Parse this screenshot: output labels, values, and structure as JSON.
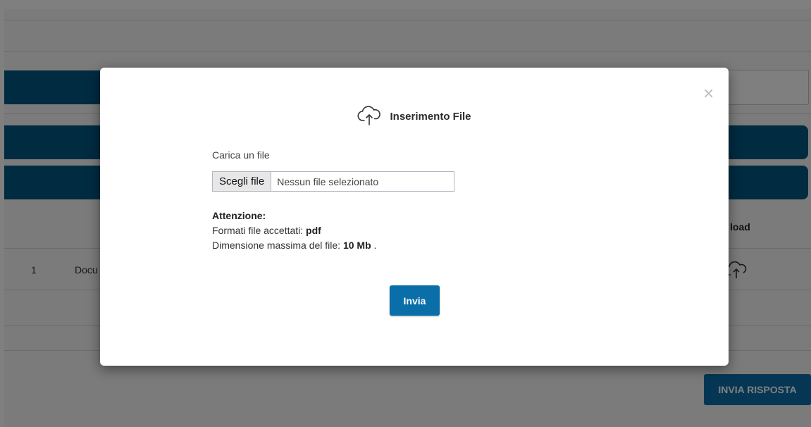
{
  "background": {
    "table_row": {
      "index": "1",
      "name_fragment": "Docu"
    },
    "table_header_fragment": "load",
    "submit_all_label": "INVIA RISPOSTA"
  },
  "modal": {
    "title": "Inserimento File",
    "close_symbol": "×",
    "file_label": "Carica un file",
    "choose_file_label": "Scegli file",
    "no_file_text": "Nessun file selezionato",
    "attention_label": "Attenzione:",
    "formats_label": "Formati file accettati: ",
    "formats_value": "pdf",
    "max_size_label": "Dimensione massima del file: ",
    "max_size_value": "10 Mb",
    "max_size_suffix": " .",
    "submit_label": "Invia",
    "icon": "cloud-upload-icon"
  },
  "colors": {
    "primary": "#005782",
    "button": "#0a6ea8",
    "overlay": "rgba(0,0,0,0.5)"
  }
}
